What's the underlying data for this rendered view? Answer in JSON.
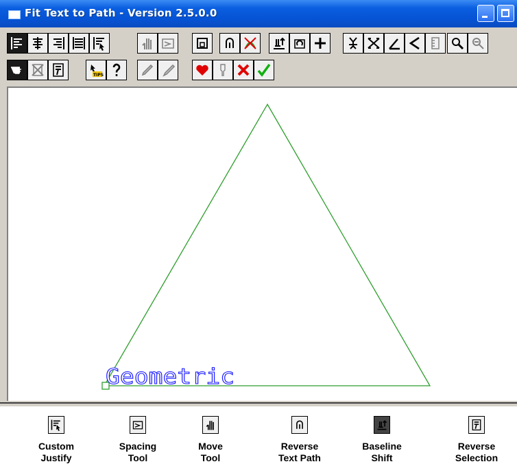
{
  "window": {
    "title": "Fit Text to Path - Version 2.5.0.0"
  },
  "toolbar_row1": [
    {
      "icon": "left-justify-icon",
      "state": "pressed"
    },
    {
      "icon": "center-justify-icon",
      "state": "normal"
    },
    {
      "icon": "right-justify-icon",
      "state": "normal"
    },
    {
      "icon": "full-justify-icon",
      "state": "normal"
    },
    {
      "icon": "custom-justify-icon",
      "state": "normal"
    },
    {
      "icon": "move-tool-icon",
      "state": "disabled"
    },
    {
      "icon": "spacing-tool-icon",
      "state": "disabled"
    },
    {
      "icon": "box-icon",
      "state": "normal"
    },
    {
      "icon": "reverse-text-path-icon",
      "state": "normal"
    },
    {
      "icon": "path-off-icon",
      "state": "normal"
    },
    {
      "icon": "baseline-shift-icon",
      "state": "normal"
    },
    {
      "icon": "rotate-icon",
      "state": "normal"
    },
    {
      "icon": "plus-icon",
      "state": "normal"
    },
    {
      "icon": "stagger-icon",
      "state": "normal"
    },
    {
      "icon": "warp-icon",
      "state": "normal"
    },
    {
      "icon": "angle-icon",
      "state": "normal"
    },
    {
      "icon": "less-than-icon",
      "state": "normal"
    },
    {
      "icon": "ruler-icon",
      "state": "disabled"
    },
    {
      "icon": "zoom-icon",
      "state": "normal"
    },
    {
      "icon": "zoom-out-icon",
      "state": "disabled"
    }
  ],
  "toolbar_row2": [
    {
      "icon": "pointer-hand-icon",
      "state": "pressed"
    },
    {
      "icon": "no-select-icon",
      "state": "disabled"
    },
    {
      "icon": "reverse-selection-icon",
      "state": "normal"
    },
    {
      "icon": "tips-icon",
      "state": "normal"
    },
    {
      "icon": "help-icon",
      "state": "normal"
    },
    {
      "icon": "pen-icon",
      "state": "disabled"
    },
    {
      "icon": "pen-alt-icon",
      "state": "disabled"
    },
    {
      "icon": "heart-icon",
      "state": "normal"
    },
    {
      "icon": "dropper-icon",
      "state": "disabled"
    },
    {
      "icon": "cancel-icon",
      "state": "normal"
    },
    {
      "icon": "ok-icon",
      "state": "normal"
    }
  ],
  "canvas": {
    "path_text": "Geometric",
    "path_color": "#2e9e2e",
    "text_color": "#1a1aff"
  },
  "legend": [
    {
      "icon": "custom-justify-icon",
      "line1": "Custom",
      "line2": "Justify"
    },
    {
      "icon": "spacing-tool-icon",
      "line1": "Spacing",
      "line2": "Tool"
    },
    {
      "icon": "move-tool-icon",
      "line1": "Move",
      "line2": "Tool"
    },
    {
      "icon": "reverse-text-path-icon",
      "line1": "Reverse",
      "line2": "Text Path"
    },
    {
      "icon": "baseline-shift-icon",
      "line1": "Baseline",
      "line2": "Shift"
    },
    {
      "icon": "reverse-selection-icon",
      "line1": "Reverse",
      "line2": "Selection"
    }
  ]
}
